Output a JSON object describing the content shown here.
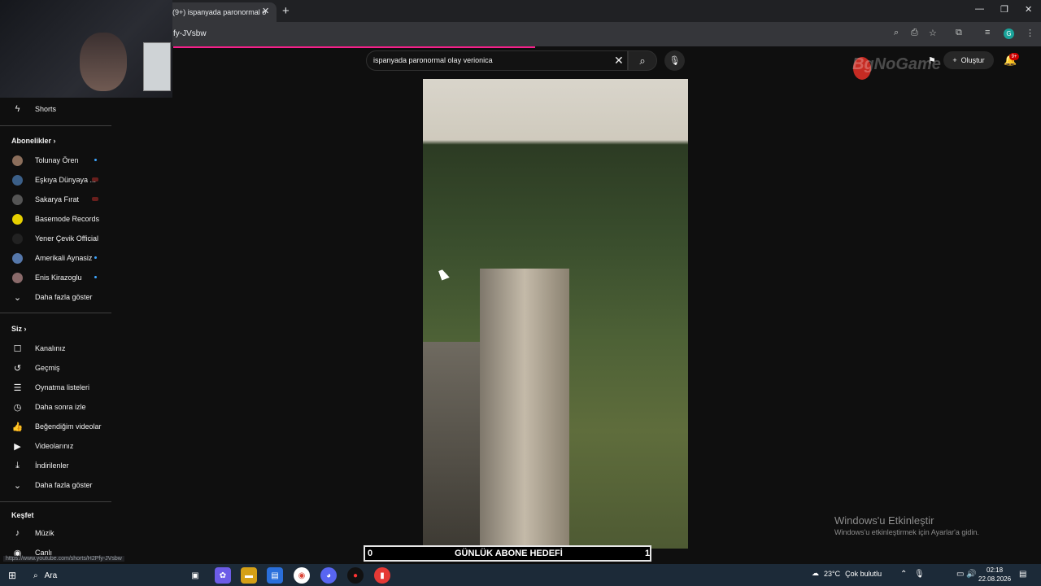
{
  "browser": {
    "tab_title": "(9+) ispanyada paronormal o",
    "url_fragment": "fy-JVsbw",
    "window_controls": [
      "minimize-icon",
      "restore-icon",
      "close-icon"
    ],
    "status_url": "https://www.youtube.com/shorts/H2Pfy-JVsbw"
  },
  "sidebar": {
    "shorts_label": "Shorts",
    "subscriptions_header": "Abonelikler",
    "subscriptions": [
      {
        "name": "Tolunay Ören",
        "indicator": "new",
        "color": "#8b6e5b"
      },
      {
        "name": "Eşkıya Dünyaya ...",
        "indicator": "live",
        "color": "#3b5f88"
      },
      {
        "name": "Sakarya Fırat",
        "indicator": "live",
        "color": "#555555"
      },
      {
        "name": "Basemode Records",
        "indicator": "",
        "color": "#e6d000"
      },
      {
        "name": "Yener Çevik Official",
        "indicator": "",
        "color": "#222222"
      },
      {
        "name": "Amerikali Aynasiz",
        "indicator": "new",
        "color": "#5577aa"
      },
      {
        "name": "Enis Kirazoglu",
        "indicator": "new",
        "color": "#8a6a6a"
      }
    ],
    "show_more_1": "Daha fazla göster",
    "you_header": "Siz",
    "you_items": [
      {
        "label": "Kanalınız",
        "icon": "channel-icon"
      },
      {
        "label": "Geçmiş",
        "icon": "history-icon"
      },
      {
        "label": "Oynatma listeleri",
        "icon": "playlist-icon"
      },
      {
        "label": "Daha sonra izle",
        "icon": "watch-later-icon"
      },
      {
        "label": "Beğendiğim videolar",
        "icon": "like-icon"
      },
      {
        "label": "Videolarınız",
        "icon": "your-videos-icon"
      },
      {
        "label": "İndirilenler",
        "icon": "download-icon"
      }
    ],
    "show_more_2": "Daha fazla göster",
    "explore_header": "Keşfet",
    "explore_items": [
      {
        "label": "Müzik",
        "icon": "music-icon"
      },
      {
        "label": "Canlı",
        "icon": "live-icon"
      }
    ]
  },
  "search": {
    "query": "ispanyada paronormal olay verionica"
  },
  "header": {
    "create_label": "Oluştur",
    "notification_count": "9+"
  },
  "watermark": {
    "logo_text": "BgNoGame"
  },
  "activation": {
    "title": "Windows'u Etkinleştir",
    "subtitle": "Windows'u etkinleştirmek için Ayarlar'a gidin."
  },
  "goal_overlay": {
    "left_value": "0",
    "label": "GÜNLÜK ABONE HEDEFİ",
    "right_value": "1"
  },
  "taskbar": {
    "search_label": "Ara",
    "weather_temp": "23°C",
    "weather_desc": "Çok bulutlu",
    "time": "02:18",
    "date": "22.08.2026"
  }
}
